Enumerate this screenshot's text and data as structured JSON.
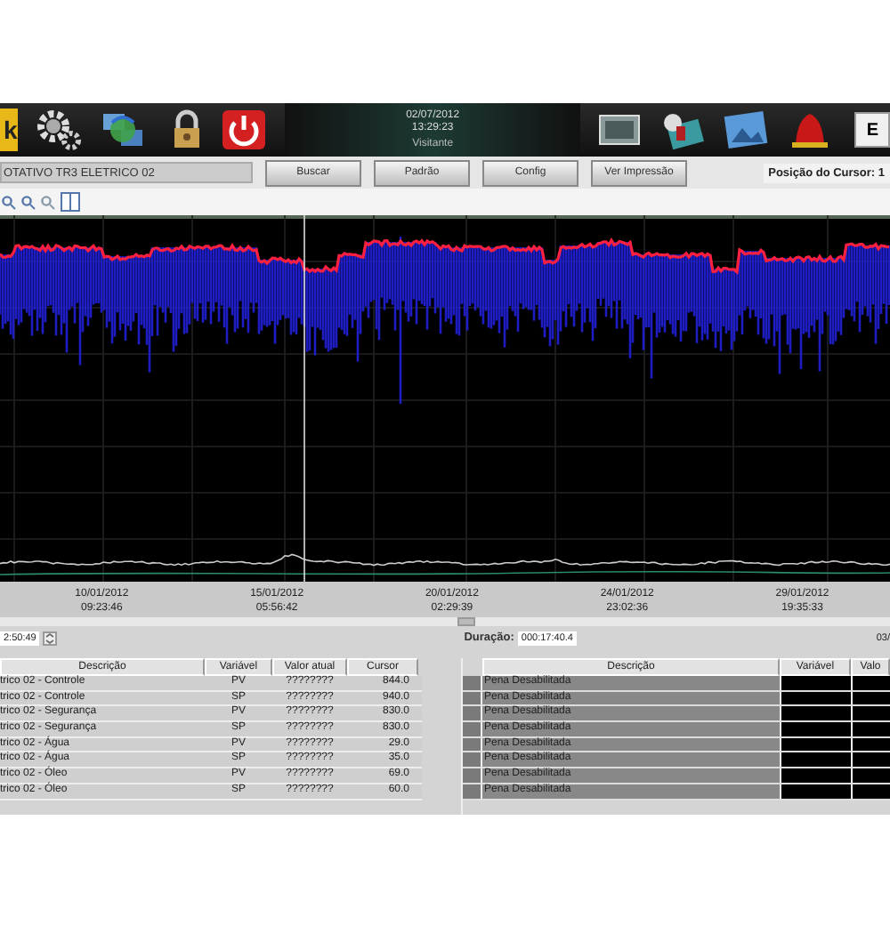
{
  "header": {
    "logo_fragment": "k",
    "date": "02/07/2012",
    "time": "13:29:23",
    "user": "Visitante",
    "e_button": "E"
  },
  "toolbar": {
    "title_field": "OTATIVO TR3 ELETRICO 02",
    "buttons": [
      "Buscar",
      "Padrão",
      "Config",
      "Ver Impressão"
    ],
    "cursor_position": "Posição do Cursor: 1"
  },
  "x_axis": [
    {
      "date": "10/01/2012",
      "time": "09:23:46"
    },
    {
      "date": "15/01/2012",
      "time": "05:56:42"
    },
    {
      "date": "20/01/2012",
      "time": "02:29:39"
    },
    {
      "date": "24/01/2012",
      "time": "23:02:36"
    },
    {
      "date": "29/01/2012",
      "time": "19:35:33"
    }
  ],
  "time_range": {
    "start": "2:50:49",
    "duration_label": "Duração:",
    "duration": "000:17:40.4",
    "end": "03/"
  },
  "pv_table": {
    "columns": [
      "Descrição",
      "Variável",
      "Valor atual",
      "Cursor"
    ],
    "rows": [
      {
        "descricao": "trico 02 - Controle",
        "variavel": "PV",
        "valor_atual": "????????",
        "cursor": "844.0"
      },
      {
        "descricao": "trico 02 - Controle",
        "variavel": "SP",
        "valor_atual": "????????",
        "cursor": "940.0"
      },
      {
        "descricao": "trico 02 - Segurança",
        "variavel": "PV",
        "valor_atual": "????????",
        "cursor": "830.0"
      },
      {
        "descricao": "trico 02 - Segurança",
        "variavel": "SP",
        "valor_atual": "????????",
        "cursor": "830.0"
      },
      {
        "descricao": "trico 02 - Água",
        "variavel": "PV",
        "valor_atual": "????????",
        "cursor": "29.0"
      },
      {
        "descricao": "trico 02 - Água",
        "variavel": "SP",
        "valor_atual": "????????",
        "cursor": "35.0"
      },
      {
        "descricao": "trico 02 - Óleo",
        "variavel": "PV",
        "valor_atual": "????????",
        "cursor": "69.0"
      },
      {
        "descricao": "trico 02 - Óleo",
        "variavel": "SP",
        "valor_atual": "????????",
        "cursor": "60.0"
      }
    ]
  },
  "pen_table": {
    "columns": [
      "Descrição",
      "Variável",
      "Valo"
    ],
    "rows": [
      {
        "descricao": "Pena Desabilitada"
      },
      {
        "descricao": "Pena Desabilitada"
      },
      {
        "descricao": "Pena Desabilitada"
      },
      {
        "descricao": "Pena Desabilitada"
      },
      {
        "descricao": "Pena Desabilitada"
      },
      {
        "descricao": "Pena Desabilitada"
      },
      {
        "descricao": "Pena Desabilitada"
      },
      {
        "descricao": "Pena Desabilitada"
      }
    ]
  }
}
